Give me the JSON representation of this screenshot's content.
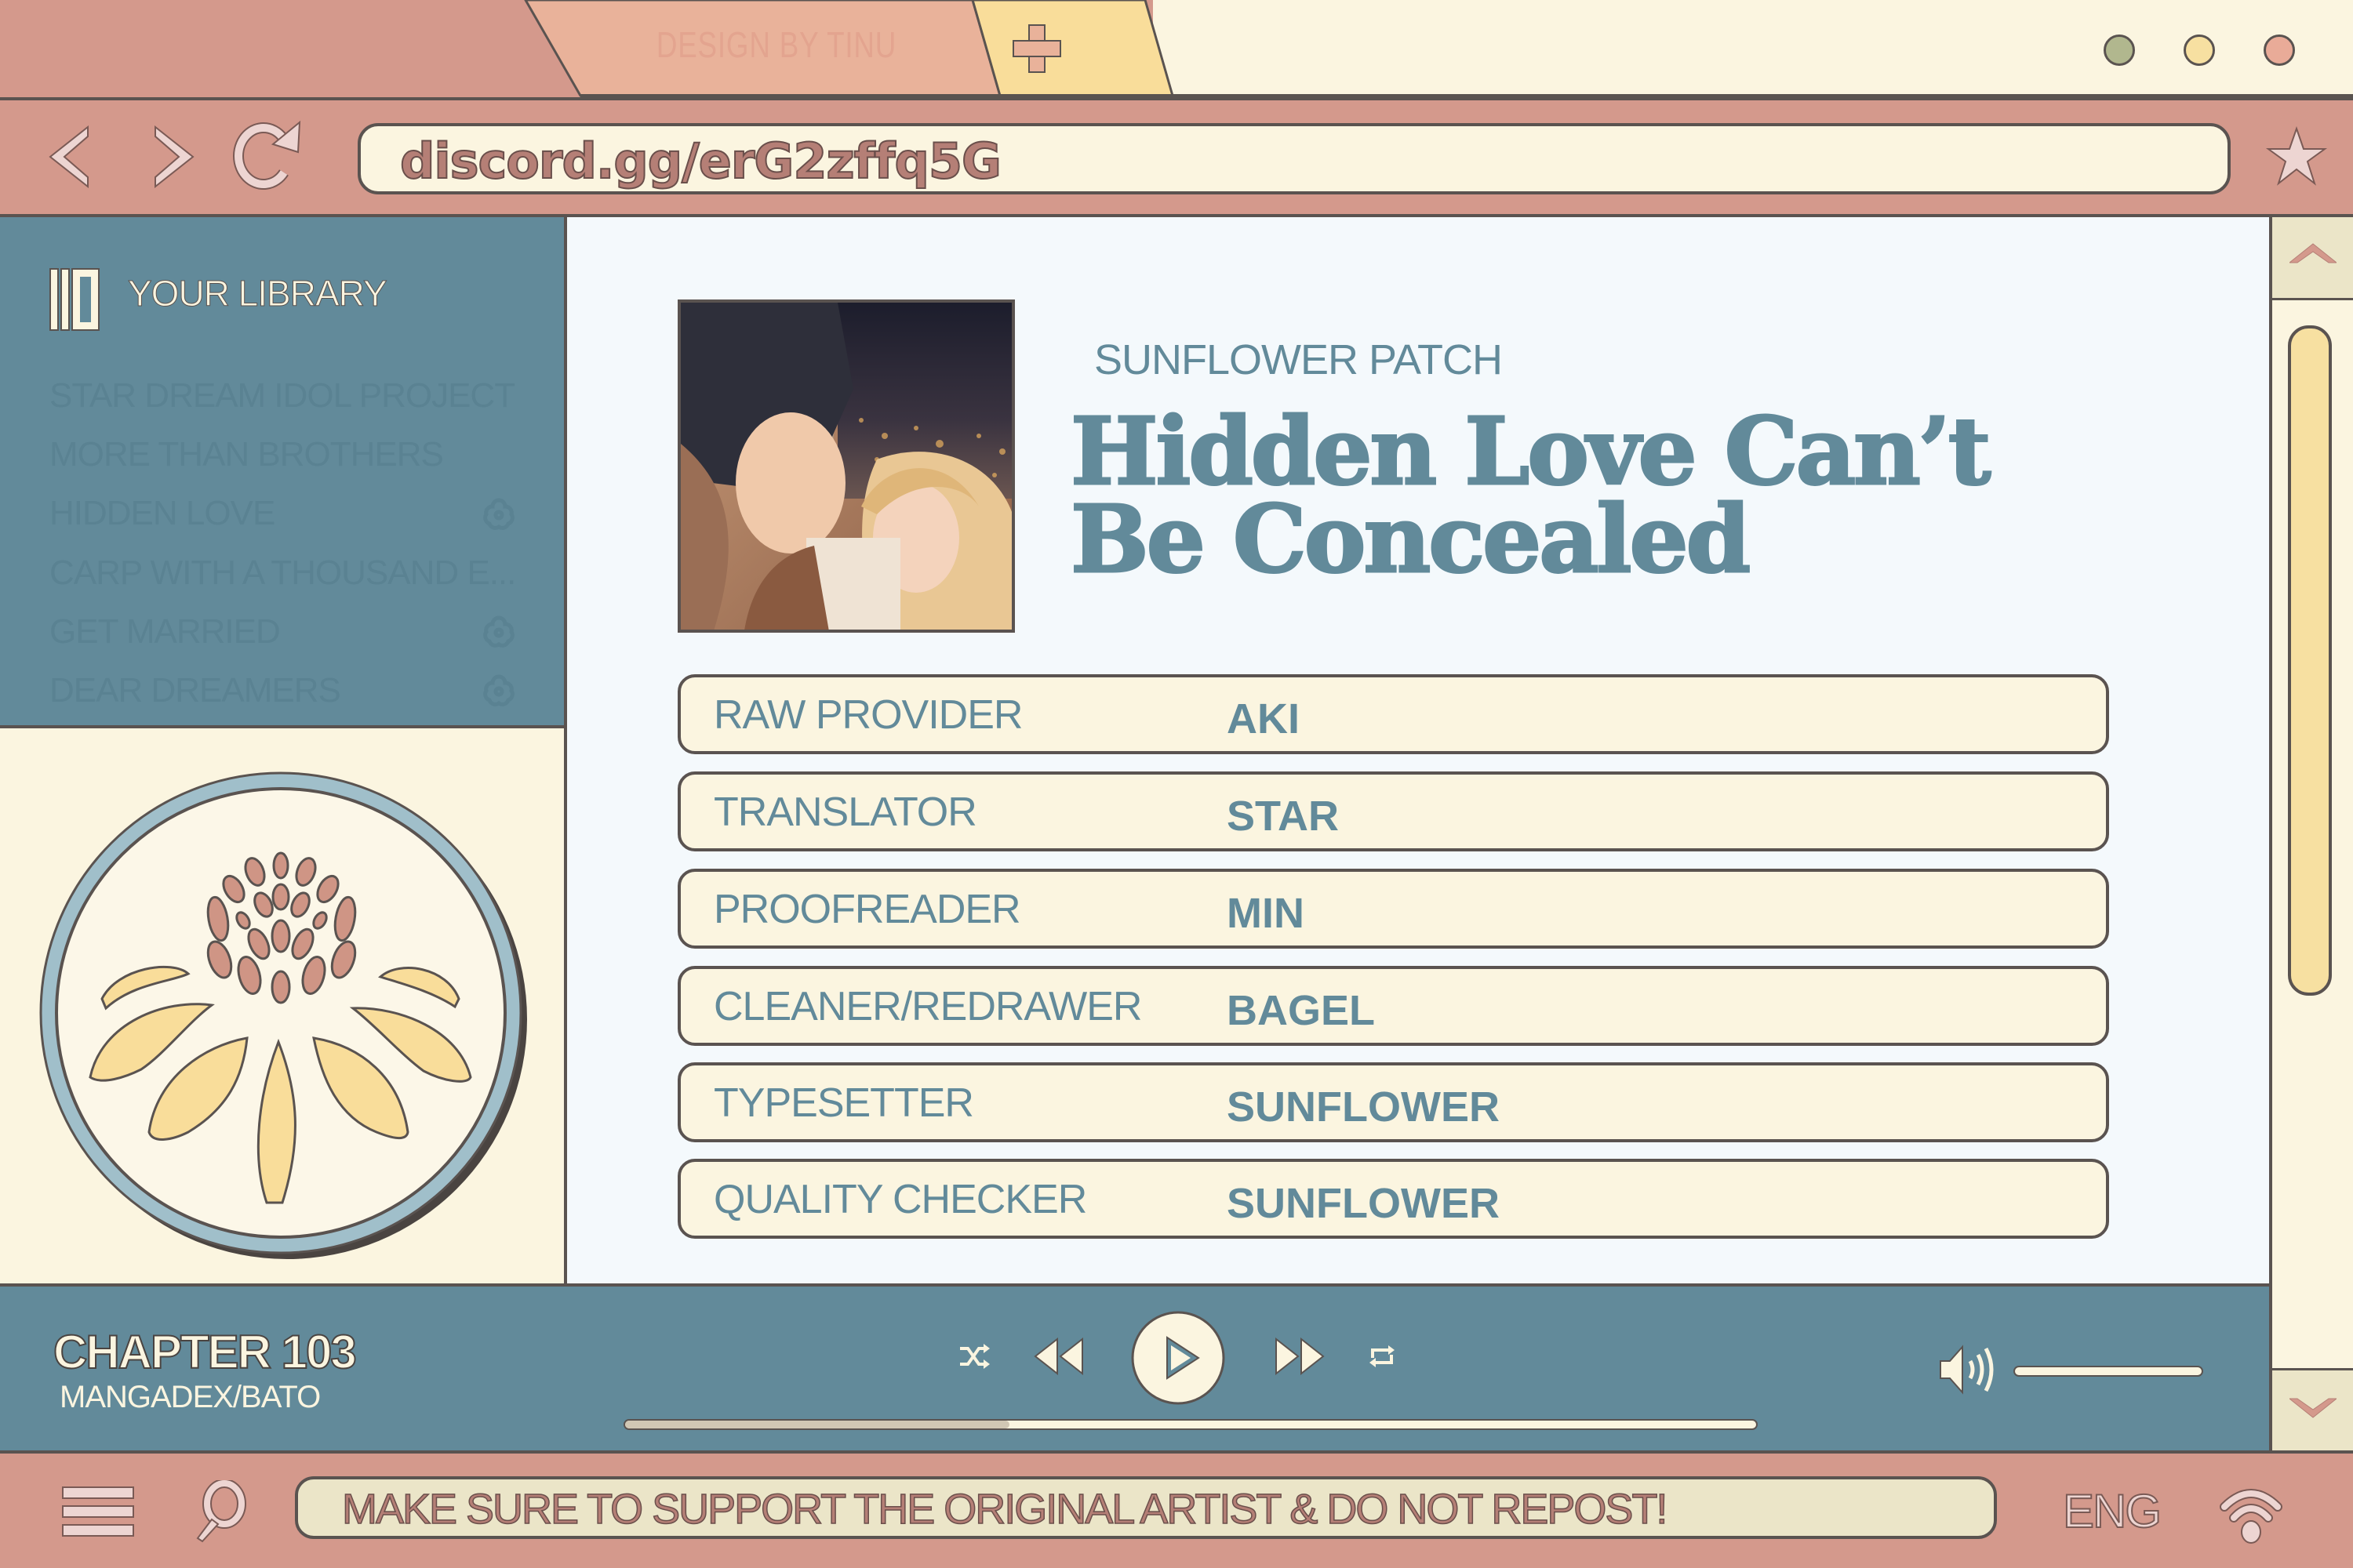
{
  "browser": {
    "tabs": [
      {
        "label": "DESIGN BY TINU",
        "active": true
      },
      {
        "label": "+",
        "type": "new-tab"
      }
    ],
    "window_controls": [
      {
        "name": "minimize",
        "color": "#b1b78e"
      },
      {
        "name": "maximize",
        "color": "#f7e0a1"
      },
      {
        "name": "close",
        "color": "#e9ab98"
      }
    ],
    "url": "discord.gg/erG2zffq5G"
  },
  "sidebar": {
    "title": "YOUR LIBRARY",
    "items": [
      {
        "label": "STAR DREAM IDOL PROJECT",
        "flower": false
      },
      {
        "label": "MORE THAN BROTHERS",
        "flower": false
      },
      {
        "label": "HIDDEN LOVE",
        "flower": true
      },
      {
        "label": "CARP WITH A THOUSAND E...",
        "flower": true
      },
      {
        "label": "GET MARRIED",
        "flower": true
      },
      {
        "label": "DEAR DREAMERS",
        "flower": true
      }
    ]
  },
  "main": {
    "group": "SUNFLOWER PATCH",
    "title_line1": "Hidden Love Can’t",
    "title_line2": "Be Concealed",
    "credits": [
      {
        "role": "RAW PROVIDER",
        "name": "AKI"
      },
      {
        "role": "TRANSLATOR",
        "name": "STAR"
      },
      {
        "role": "PROOFREADER",
        "name": "MIN"
      },
      {
        "role": "CLEANER/REDRAWER",
        "name": "BAGEL"
      },
      {
        "role": "TYPESETTER",
        "name": "SUNFLOWER"
      },
      {
        "role": "QUALITY CHECKER",
        "name": "SUNFLOWER"
      }
    ]
  },
  "player": {
    "chapter": "CHAPTER 103",
    "source": "MANGADEX/BATO",
    "progress_percent": 34,
    "volume_percent": 100
  },
  "bottom": {
    "notice": "MAKE SURE TO SUPPORT THE ORIGINAL ARTIST & DO NOT REPOST!",
    "language": "ENG"
  },
  "colors": {
    "rose": "#d4998c",
    "cream": "#fbf5e0",
    "teal": "#628a9a",
    "yellow": "#f7e0a1",
    "peach": "#e9b29a",
    "outline": "#5a5350"
  }
}
